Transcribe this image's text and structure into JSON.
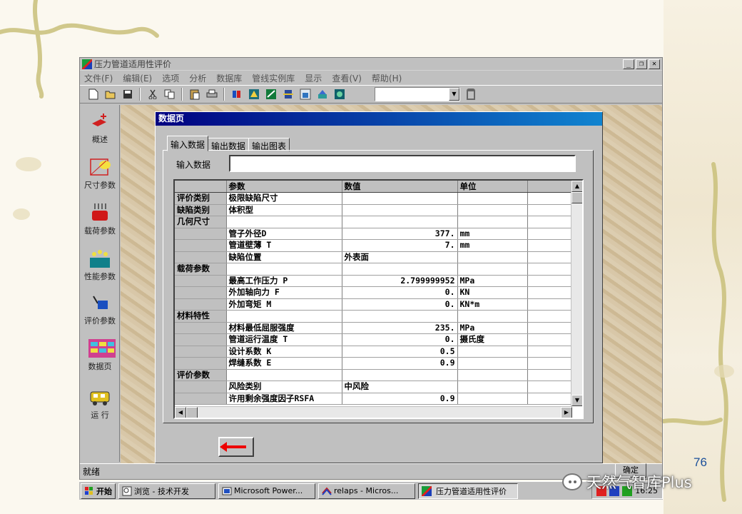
{
  "slide": {
    "number": "76",
    "watermark": "天然气智库Plus"
  },
  "app": {
    "title": "压力管道适用性评价",
    "menu": [
      "文件(F)",
      "编辑(E)",
      "选项",
      "分析",
      "数据库",
      "管线实例库",
      "显示",
      "查看(V)",
      "帮助(H)"
    ],
    "toolbar": {
      "combo_value": "",
      "icons": [
        "new-icon",
        "open-icon",
        "save-icon",
        "cut-icon",
        "copy-icon",
        "paste-icon",
        "print-icon",
        "tool-1-icon",
        "tool-2-icon",
        "tool-3-icon",
        "tool-4-icon",
        "tool-5-icon",
        "tool-6-icon",
        "tool-7-icon"
      ]
    },
    "sidebar": [
      {
        "label": "概述",
        "icon": "overview-icon"
      },
      {
        "label": "尺寸参数",
        "icon": "dimension-icon"
      },
      {
        "label": "载荷参数",
        "icon": "load-icon"
      },
      {
        "label": "性能参数",
        "icon": "performance-icon"
      },
      {
        "label": "评价参数",
        "icon": "evaluation-icon"
      },
      {
        "label": "数据页",
        "icon": "datasheet-icon"
      },
      {
        "label": "运 行",
        "icon": "run-icon"
      }
    ],
    "status": "就绪",
    "ok_label": "确定"
  },
  "child": {
    "title": "数据页",
    "tabs": [
      "输入数据",
      "输出数据",
      "输出图表"
    ],
    "input_label": "输入数据",
    "input_value": "",
    "grid": {
      "columns": [
        "",
        "参数",
        "数值",
        "单位",
        ""
      ],
      "rows": [
        [
          "评价类别",
          "极限缺陷尺寸",
          "",
          "",
          ""
        ],
        [
          "缺陷类别",
          "体积型",
          "",
          "",
          ""
        ],
        [
          "几何尺寸",
          "",
          "",
          "",
          ""
        ],
        [
          "",
          "管子外径D",
          "377.",
          "mm",
          ""
        ],
        [
          "",
          "管道壁薄 T",
          "7.",
          "mm",
          ""
        ],
        [
          "",
          "缺陷位置",
          "外表面",
          "",
          ""
        ],
        [
          "载荷参数",
          "",
          "",
          "",
          ""
        ],
        [
          "",
          "最高工作压力 P",
          "2.799999952",
          "MPa",
          ""
        ],
        [
          "",
          "外加轴向力 F",
          "0.",
          "KN",
          ""
        ],
        [
          "",
          "外加弯矩 M",
          "0.",
          "KN*m",
          ""
        ],
        [
          "材料特性",
          "",
          "",
          "",
          ""
        ],
        [
          "",
          "材料最低屈服强度",
          "235.",
          "MPa",
          ""
        ],
        [
          "",
          "管道运行温度 T",
          "0.",
          "摄氏度",
          ""
        ],
        [
          "",
          "设计系数 K",
          "0.5",
          "",
          ""
        ],
        [
          "",
          "焊缝系数 E",
          "0.9",
          "",
          ""
        ],
        [
          "评价参数",
          "",
          "",
          "",
          ""
        ],
        [
          "",
          "风险类别",
          "中风险",
          "",
          ""
        ],
        [
          "",
          "许用剩余强度因子RSFA",
          "0.9",
          "",
          ""
        ]
      ],
      "left_aligned_values": [
        "外表面",
        "中风险"
      ]
    }
  },
  "taskbar": {
    "start": "开始",
    "tasks": [
      {
        "label": "浏览 - 技术开发",
        "icon": "browser-icon"
      },
      {
        "label": "Microsoft Power...",
        "icon": "powerpoint-icon"
      },
      {
        "label": "relaps - Micros...",
        "icon": "document-icon"
      },
      {
        "label": "压力管道适用性评价",
        "icon": "app-icon",
        "active": true
      }
    ],
    "clock": "16:25"
  }
}
